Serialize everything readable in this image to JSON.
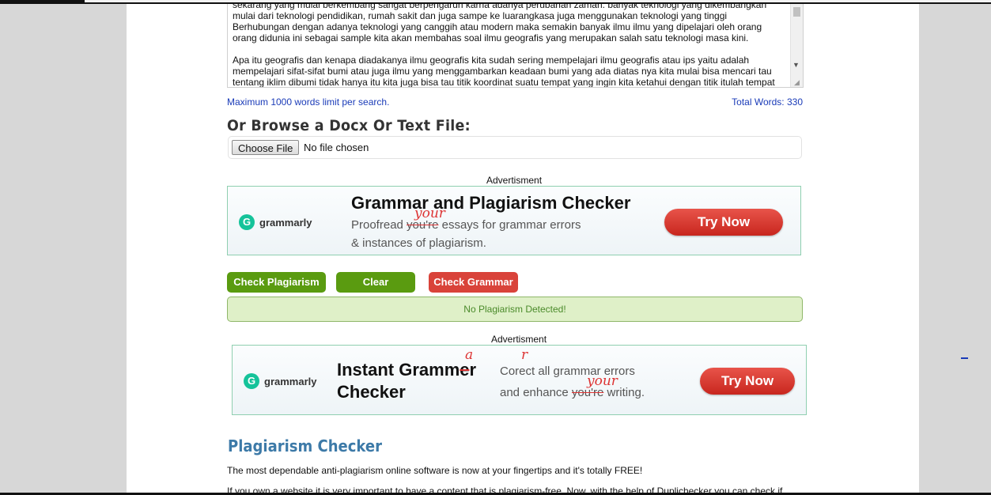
{
  "textarea": {
    "paragraphs": [
      "sekarang yang mulai berkembang sangat berpengaruh karna adanya perubahan zaman. banyak teknologi yang dikembangkan mulai dari teknologi pendidikan, rumah sakit dan juga sampe ke luarangkasa juga menggunakan teknologi yang tinggi Berhubungan dengan adanya teknologi yang canggih atau modern maka semakin banyak ilmu ilmu yang dipelajari oleh orang orang didunia ini sebagai sample kita akan membahas soal ilmu geografis yang merupakan salah satu teknologi masa kini.",
      "Apa itu geografis dan kenapa diadakanya ilmu geografis kita sudah sering mempelajari ilmu geografis atau ips yaitu adalah mempelajari sifat-sifat bumi atau juga ilmu yang menggambarkan keadaan bumi yang ada diatas nya kita mulai bisa mencari tau tentang iklim dibumi tidak hanya itu kita juga bisa tau titik koordinat suatu tempat yang ingin kita ketahui dengan titik itulah tempat"
    ]
  },
  "limit_text": "Maximum 1000 words limit per search.",
  "total_words": "Total Words: 330",
  "browse": {
    "title": "Or Browse a Docx Or Text File:",
    "choose_file": "Choose File",
    "no_file": "No file chosen"
  },
  "ad1": {
    "label": "Advertisment",
    "brand": "grammarly",
    "title": "Grammar and Plagiarism Checker",
    "sub_line1_pre": "Proofread ",
    "sub_line1_strike": "you're",
    "sub_line1_post": " essays for grammar errors",
    "sub_line2": "& instances of plagiarism.",
    "correction": "your",
    "cta": "Try Now"
  },
  "buttons": {
    "check_plagiarism": "Check Plagiarism",
    "clear": "Clear",
    "check_grammar": "Check Grammar"
  },
  "result": "No Plagiarism Detected!",
  "ad2": {
    "label": "Advertisment",
    "brand": "grammarly",
    "title_line1_pre": "Instant Gramm",
    "title_line1_strike": "e",
    "title_line1_post": "r",
    "title_line2": "Checker",
    "title_correction": "a",
    "sub_line1_pre": "Corect",
    "sub_line1_post": " all grammar errors",
    "sub_correction_r": "r",
    "sub_line2_pre": "and enhance ",
    "sub_line2_strike": "you're",
    "sub_line2_post": " writing.",
    "correction": "your",
    "cta": "Try Now"
  },
  "section": {
    "title": "Plagiarism Checker",
    "para1": "The most dependable anti-plagiarism online software is now at your fingertips and it's totally FREE!",
    "para2": "If you own a website it is very important to have a content that is plagiarism-free. Now, with the help of Duplichecker you can check if"
  },
  "colors": {
    "accent_green": "#5a9b10",
    "accent_red": "#d9433a",
    "link_blue": "#1a3bb8",
    "title_blue": "#3d7aa8",
    "result_bg": "#dff0c8"
  }
}
